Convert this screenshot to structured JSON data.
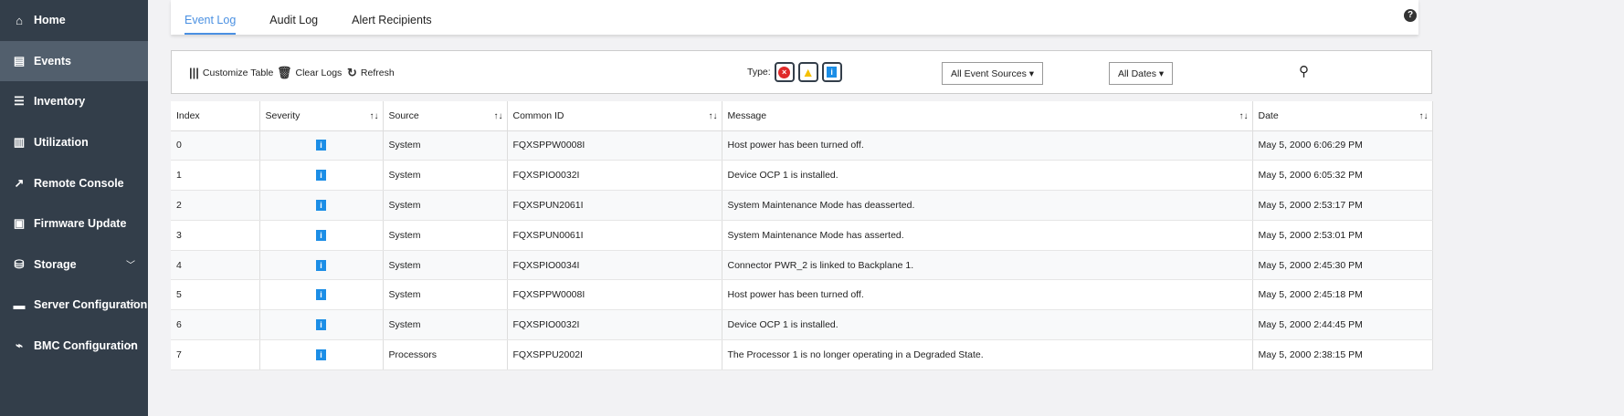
{
  "sidebar": {
    "items": [
      {
        "label": "Home",
        "icon": "home-icon",
        "glyph": "⌂"
      },
      {
        "label": "Events",
        "icon": "events-icon",
        "glyph": "▤",
        "active": true
      },
      {
        "label": "Inventory",
        "icon": "list-icon",
        "glyph": "☰"
      },
      {
        "label": "Utilization",
        "icon": "chart-icon",
        "glyph": "▥"
      },
      {
        "label": "Remote Console",
        "icon": "external-link-icon",
        "glyph": "↗"
      },
      {
        "label": "Firmware Update",
        "icon": "chip-icon",
        "glyph": "▣"
      },
      {
        "label": "Storage",
        "icon": "database-icon",
        "glyph": "⛁",
        "chevron": true
      },
      {
        "label": "Server Configuration",
        "icon": "server-icon",
        "glyph": "▬",
        "chevron": true
      },
      {
        "label": "BMC Configuration",
        "icon": "pulse-icon",
        "glyph": "⌁",
        "chevron": true
      }
    ]
  },
  "tabs": [
    "Event Log",
    "Audit Log",
    "Alert Recipients"
  ],
  "help": "?",
  "toolbar": {
    "customize": "Customize Table",
    "clear": "Clear Logs",
    "refresh": "Refresh",
    "type_label": "Type:",
    "sources": "All Event Sources",
    "dates": "All Dates"
  },
  "colors": {
    "accent": "#4a90e2",
    "sidebar": "#333e4a",
    "info": "#1c8ee6",
    "error": "#e02a2a",
    "warning": "#f5c000"
  },
  "table": {
    "headers": [
      "Index",
      "Severity",
      "Source",
      "Common ID",
      "Message",
      "Date"
    ],
    "rows": [
      [
        "0",
        "i",
        "System",
        "FQXSPPW0008I",
        "Host power has been turned off.",
        "May 5, 2000 6:06:29 PM"
      ],
      [
        "1",
        "i",
        "System",
        "FQXSPIO0032I",
        "Device OCP 1 is installed.",
        "May 5, 2000 6:05:32 PM"
      ],
      [
        "2",
        "i",
        "System",
        "FQXSPUN2061I",
        "System Maintenance Mode has deasserted.",
        "May 5, 2000 2:53:17 PM"
      ],
      [
        "3",
        "i",
        "System",
        "FQXSPUN0061I",
        "System Maintenance Mode has asserted.",
        "May 5, 2000 2:53:01 PM"
      ],
      [
        "4",
        "i",
        "System",
        "FQXSPIO0034I",
        "Connector PWR_2 is linked to Backplane 1.",
        "May 5, 2000 2:45:30 PM"
      ],
      [
        "5",
        "i",
        "System",
        "FQXSPPW0008I",
        "Host power has been turned off.",
        "May 5, 2000 2:45:18 PM"
      ],
      [
        "6",
        "i",
        "System",
        "FQXSPIO0032I",
        "Device OCP 1 is installed.",
        "May 5, 2000 2:44:45 PM"
      ],
      [
        "7",
        "i",
        "Processors",
        "FQXSPPU2002I",
        "The Processor 1 is no longer operating in a Degraded State.",
        "May 5, 2000 2:38:15 PM"
      ]
    ]
  }
}
